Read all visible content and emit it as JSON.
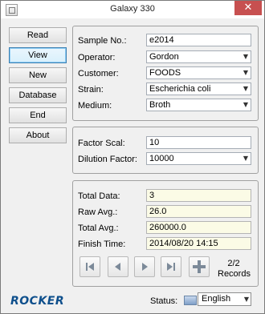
{
  "window": {
    "title": "Galaxy 330",
    "close_glyph": "✕"
  },
  "nav": [
    {
      "label": "Read"
    },
    {
      "label": "View"
    },
    {
      "label": "New"
    },
    {
      "label": "Database"
    },
    {
      "label": "End"
    },
    {
      "label": "About"
    }
  ],
  "sample": {
    "sample_no": {
      "label": "Sample No.:",
      "value": "e2014"
    },
    "operator": {
      "label": "Operator:",
      "value": "Gordon"
    },
    "customer": {
      "label": "Customer:",
      "value": "FOODS"
    },
    "strain": {
      "label": "Strain:",
      "value": "Escherichia coli"
    },
    "medium": {
      "label": "Medium:",
      "value": "Broth"
    }
  },
  "factors": {
    "factor_scal": {
      "label": "Factor Scal:",
      "value": "10"
    },
    "dilution_factor": {
      "label": "Dilution Factor:",
      "value": "10000"
    }
  },
  "results": {
    "total_data": {
      "label": "Total Data:",
      "value": "3"
    },
    "raw_avg": {
      "label": "Raw Avg.:",
      "value": "26.0"
    },
    "total_avg": {
      "label": "Total Avg.:",
      "value": "260000.0"
    },
    "finish_time": {
      "label": "Finish Time:",
      "value": "2014/08/20 14:15"
    }
  },
  "record_nav": {
    "icons": [
      "first-record-icon",
      "previous-record-icon",
      "next-record-icon",
      "last-record-icon",
      "add-record-icon"
    ],
    "count": "2/2",
    "records_label": "Records"
  },
  "footer": {
    "logo_text": "ROCKER",
    "status_label": "Status:",
    "language": "English"
  },
  "colors": {
    "accent": "#0e4f8c",
    "close_button": "#c75050",
    "readonly_field": "#fbfbe6"
  }
}
